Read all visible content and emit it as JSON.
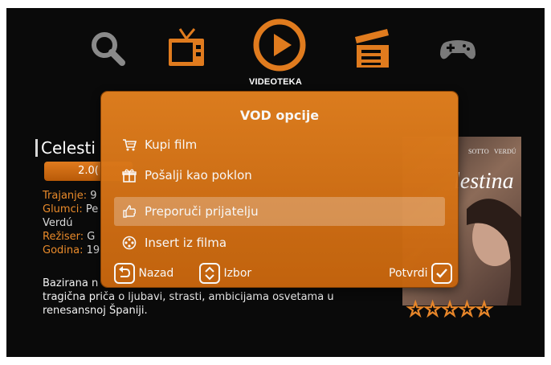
{
  "nav": {
    "active_label": "VIDEOTEKA",
    "icons": [
      "search-icon",
      "tv-icon",
      "play-icon",
      "clapperboard-icon",
      "gamepad-icon"
    ]
  },
  "movie": {
    "title": "Celesti",
    "price": "2.0(",
    "duration_key": "Trajanje:",
    "duration_val": "9",
    "cast_key": "Glumci:",
    "cast_val": "Pe",
    "cast_line2": "Verdú",
    "director_key": "Režiser:",
    "director_val": "G",
    "year_key": "Godina:",
    "year_val": "19",
    "description_line1": "Bazirana n",
    "description_line2": "tragična priča o ljubavi, strasti, ambicijama osvetama u",
    "description_line3": "renesansnoj Španiji.",
    "poster_actor1": "SOTTO",
    "poster_actor2": "VERDÚ",
    "poster_title": "lestina",
    "rating_stars": 0
  },
  "popup": {
    "title": "VOD opcije",
    "options": [
      {
        "label": "Kupi film",
        "icon": "cart-icon",
        "selected": false
      },
      {
        "label": "Pošalji kao poklon",
        "icon": "gift-icon",
        "selected": false
      },
      {
        "label": "Preporuči prijatelju",
        "icon": "thumbs-up-icon",
        "selected": true
      },
      {
        "label": "Insert iz filma",
        "icon": "film-reel-icon",
        "selected": false
      }
    ],
    "footer": {
      "back_label": "Nazad",
      "select_label": "Izbor",
      "confirm_label": "Potvrdi"
    }
  },
  "colors": {
    "accent": "#e07b1e",
    "background": "#0a0a0a"
  }
}
